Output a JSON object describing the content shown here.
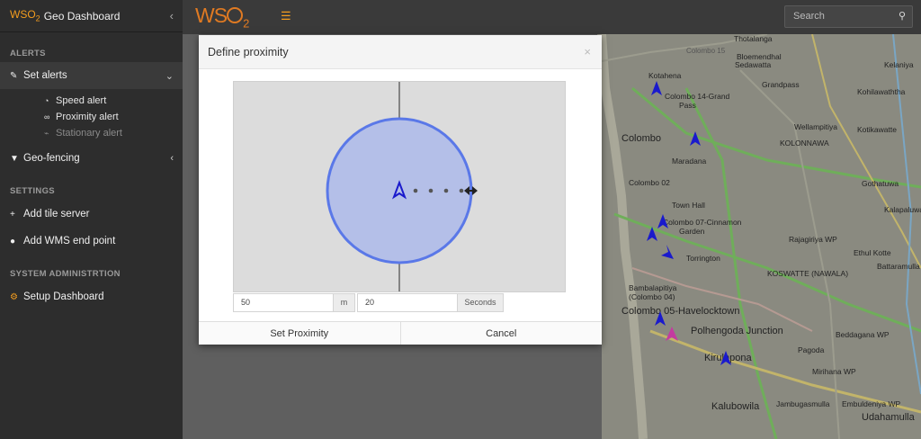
{
  "brand": {
    "wso": "WSO",
    "wso_sub": "2",
    "title": "Geo Dashboard"
  },
  "sidebar": {
    "alerts_head": "ALERTS",
    "set_alerts": "Set alerts",
    "speed_alert": "Speed alert",
    "proximity_alert": "Proximity alert",
    "stationary_alert": "Stationary alert",
    "geo_fencing": "Geo-fencing",
    "settings_head": "SETTINGS",
    "add_tile_server": "Add tile server",
    "add_wms": "Add WMS end point",
    "sysadmin_head": "SYSTEM ADMINISTRTION",
    "setup_dashboard": "Setup Dashboard"
  },
  "topbar": {
    "logo": "WS",
    "logo_sub": "2",
    "search_placeholder": "Search"
  },
  "modal": {
    "title": "Define proximity",
    "close": "×",
    "distance_value": "50",
    "distance_unit": "m",
    "time_value": "20",
    "time_unit": "Seconds",
    "set_button": "Set Proximity",
    "cancel_button": "Cancel"
  },
  "map": {
    "top_label": "Colombo 15",
    "labels": {
      "kotahena": "Kotahena",
      "colombo14": "Colombo 14-Grand",
      "pass": "Pass",
      "colombo": "Colombo",
      "maradana": "Maradana",
      "colombo02": "Colombo 02",
      "townhall": "Town Hall",
      "colombo07": "Colombo 07-Cinnamon",
      "garden": "Garden",
      "torrington": "Torrington",
      "bambalapitiya": "Bambalapitiya",
      "colombo04": "(Colombo 04)",
      "havelocktown": "Colombo 05-Havelocktown",
      "polhengoda": "Polhengoda Junction",
      "kirulapona": "Kirulapona",
      "kalubowila": "Kalubowila",
      "udahamulla": "Udahamulla",
      "sedawatta": "Sedawatta",
      "grandpass": "Grandpass",
      "kelaniya": "Kelaniya",
      "kohilawaththa": "Kohilawaththa",
      "wellampitiya": "Wellampitiya",
      "kotikawatte": "Kotikawatte",
      "kolonnawa": "KOLONNAWA",
      "gothatuwa": "Gothatuwa",
      "kalapaluwawa": "Kalapaluwawa",
      "rajagiriya": "Rajagiriya WP",
      "ethulkotte": "Ethul Kotte",
      "battaramulla": "Battaramulla",
      "koswatte": "KOSWATTE (NAWALA)",
      "pagoda": "Pagoda",
      "beddagana": "Beddagana WP",
      "mirihana": "Mirihana WP",
      "jambugas": "Jambugasmulla",
      "embuldeniya": "Embuldeniya WP",
      "thotalanga": "Thotalanga",
      "bloemendhal": "Bloemendhal"
    }
  },
  "colors": {
    "accent": "#f39c1e",
    "circle_fill": "#b4bfe8",
    "circle_stroke": "#5a78e8",
    "marker": "#1a1acc",
    "marker_alt": "#c43ba0"
  }
}
